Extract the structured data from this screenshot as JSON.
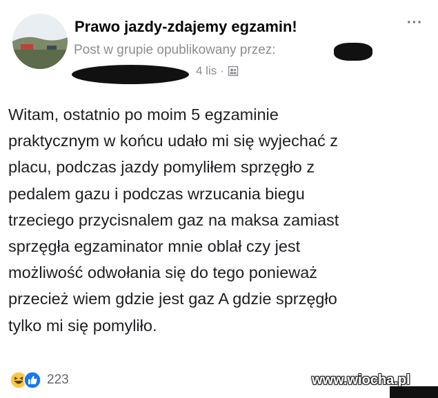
{
  "header": {
    "group_name": "Prawo jazdy-zdajemy egzamin!",
    "meta_text": "Post w grupie opublikowany przez:",
    "date": "4 lis",
    "separator": "·",
    "more_label": "···"
  },
  "post": {
    "lines": [
      "Witam, ostatnio po moim 5 egzaminie",
      "praktycznym w końcu udało mi się wyjechać z",
      "placu, podczas jazdy pomyliłem sprzęgło z",
      "pedalem gazu i podczas wrzucania biegu",
      "trzeciego przycisnalem gaz na maksa zamiast",
      "sprzęgła egzaminator mnie oblał czy jest",
      "możliwość odwołania się do tego ponieważ",
      "przecież wiem gdzie jest gaz A gdzie sprzęgło",
      "tylko mi się pomyliło."
    ]
  },
  "footer": {
    "reaction_count": "223",
    "reaction_icons": [
      "haha-icon",
      "like-icon"
    ],
    "watermark": "www.wiocha.pl"
  },
  "colors": {
    "text": "#1c1e21",
    "secondary": "#8a8d91",
    "like_blue": "#1877f2",
    "haha_yellow": "#f7c844"
  }
}
